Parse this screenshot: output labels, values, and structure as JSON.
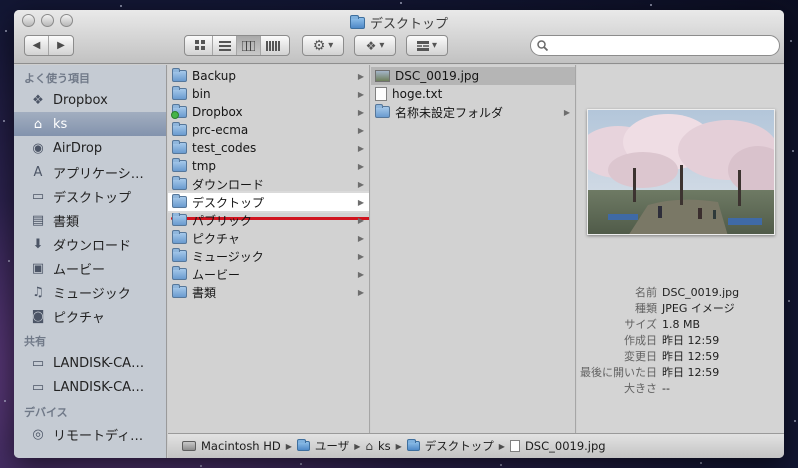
{
  "window": {
    "title": "デスクトップ"
  },
  "toolbar": {
    "search_value": ""
  },
  "sidebar": {
    "sections": [
      {
        "title": "よく使う項目",
        "items": [
          {
            "label": "Dropbox",
            "icon": "dropbox-icon",
            "selected": false
          },
          {
            "label": "ks",
            "icon": "home-icon",
            "selected": true
          },
          {
            "label": "AirDrop",
            "icon": "airdrop-icon",
            "selected": false
          },
          {
            "label": "アプリケーシ…",
            "icon": "applications-icon",
            "selected": false
          },
          {
            "label": "デスクトップ",
            "icon": "desktop-icon",
            "selected": false
          },
          {
            "label": "書類",
            "icon": "documents-icon",
            "selected": false
          },
          {
            "label": "ダウンロード",
            "icon": "downloads-icon",
            "selected": false
          },
          {
            "label": "ムービー",
            "icon": "movies-icon",
            "selected": false
          },
          {
            "label": "ミュージック",
            "icon": "music-icon",
            "selected": false
          },
          {
            "label": "ピクチャ",
            "icon": "pictures-icon",
            "selected": false
          }
        ]
      },
      {
        "title": "共有",
        "items": [
          {
            "label": "LANDISK-CA…",
            "icon": "network-display-icon",
            "selected": false
          },
          {
            "label": "LANDISK-CA…",
            "icon": "network-display-icon",
            "selected": false
          }
        ]
      },
      {
        "title": "デバイス",
        "items": [
          {
            "label": "リモートディ…",
            "icon": "remote-disc-icon",
            "selected": false
          }
        ]
      }
    ]
  },
  "column1": {
    "items": [
      {
        "label": "Backup",
        "has_children": true
      },
      {
        "label": "bin",
        "has_children": true
      },
      {
        "label": "Dropbox",
        "has_children": true,
        "badge": true
      },
      {
        "label": "prc-ecma",
        "has_children": true
      },
      {
        "label": "test_codes",
        "has_children": true
      },
      {
        "label": "tmp",
        "has_children": true
      },
      {
        "label": "ダウンロード",
        "has_children": true
      },
      {
        "label": "デスクトップ",
        "has_children": true,
        "selected": true
      },
      {
        "label": "パブリック",
        "has_children": true
      },
      {
        "label": "ピクチャ",
        "has_children": true
      },
      {
        "label": "ミュージック",
        "has_children": true
      },
      {
        "label": "ムービー",
        "has_children": true
      },
      {
        "label": "書類",
        "has_children": true
      }
    ]
  },
  "column2": {
    "items": [
      {
        "label": "DSC_0019.jpg",
        "type": "image",
        "selected": true
      },
      {
        "label": "hoge.txt",
        "type": "text"
      },
      {
        "label": "名称未設定フォルダ",
        "type": "folder",
        "has_children": true
      }
    ]
  },
  "preview": {
    "info": [
      {
        "key": "名前",
        "value": "DSC_0019.jpg"
      },
      {
        "key": "種類",
        "value": "JPEG イメージ"
      },
      {
        "key": "サイズ",
        "value": "1.8 MB"
      },
      {
        "key": "作成日",
        "value": "昨日 12:59"
      },
      {
        "key": "変更日",
        "value": "昨日 12:59"
      },
      {
        "key": "最後に開いた日",
        "value": "昨日 12:59"
      },
      {
        "key": "大きさ",
        "value": "--"
      }
    ]
  },
  "pathbar": {
    "segments": [
      {
        "label": "Macintosh HD",
        "icon": "hard-drive-icon"
      },
      {
        "label": "ユーザ",
        "icon": "folder-icon"
      },
      {
        "label": "ks",
        "icon": "home-icon"
      },
      {
        "label": "デスクトップ",
        "icon": "folder-icon"
      },
      {
        "label": "DSC_0019.jpg",
        "icon": "file-icon"
      }
    ]
  },
  "colors": {
    "highlight_red": "#d0141f",
    "sidebar_bg": "#c5cbd3",
    "sidebar_selected": "#8393ad"
  }
}
